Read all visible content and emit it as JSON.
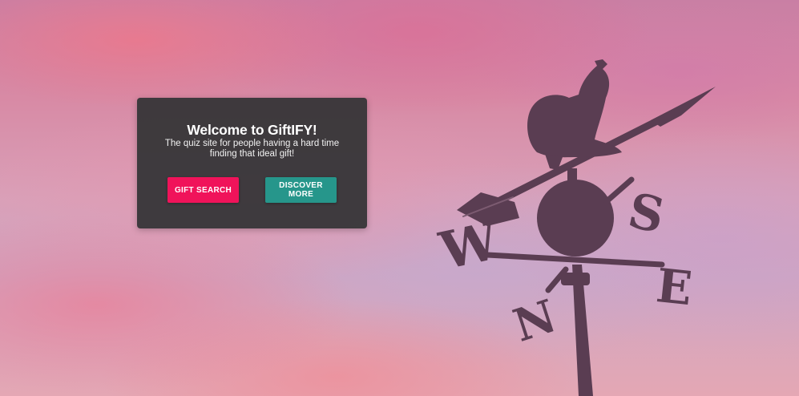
{
  "hero": {
    "title": "Welcome to GiftIFY!",
    "subtitle": "The quiz site for people having a hard time finding that ideal gift!",
    "gift_search_label": "GIFT SEARCH",
    "discover_more_label": "DISCOVER MORE"
  },
  "colors": {
    "card_background": "#343436",
    "gift_search_button": "#f0135a",
    "discover_more_button": "#26968b",
    "weathervane_silhouette": "#5a3d52"
  },
  "background": {
    "weathervane_letters": [
      "W",
      "S",
      "E",
      "N"
    ]
  }
}
